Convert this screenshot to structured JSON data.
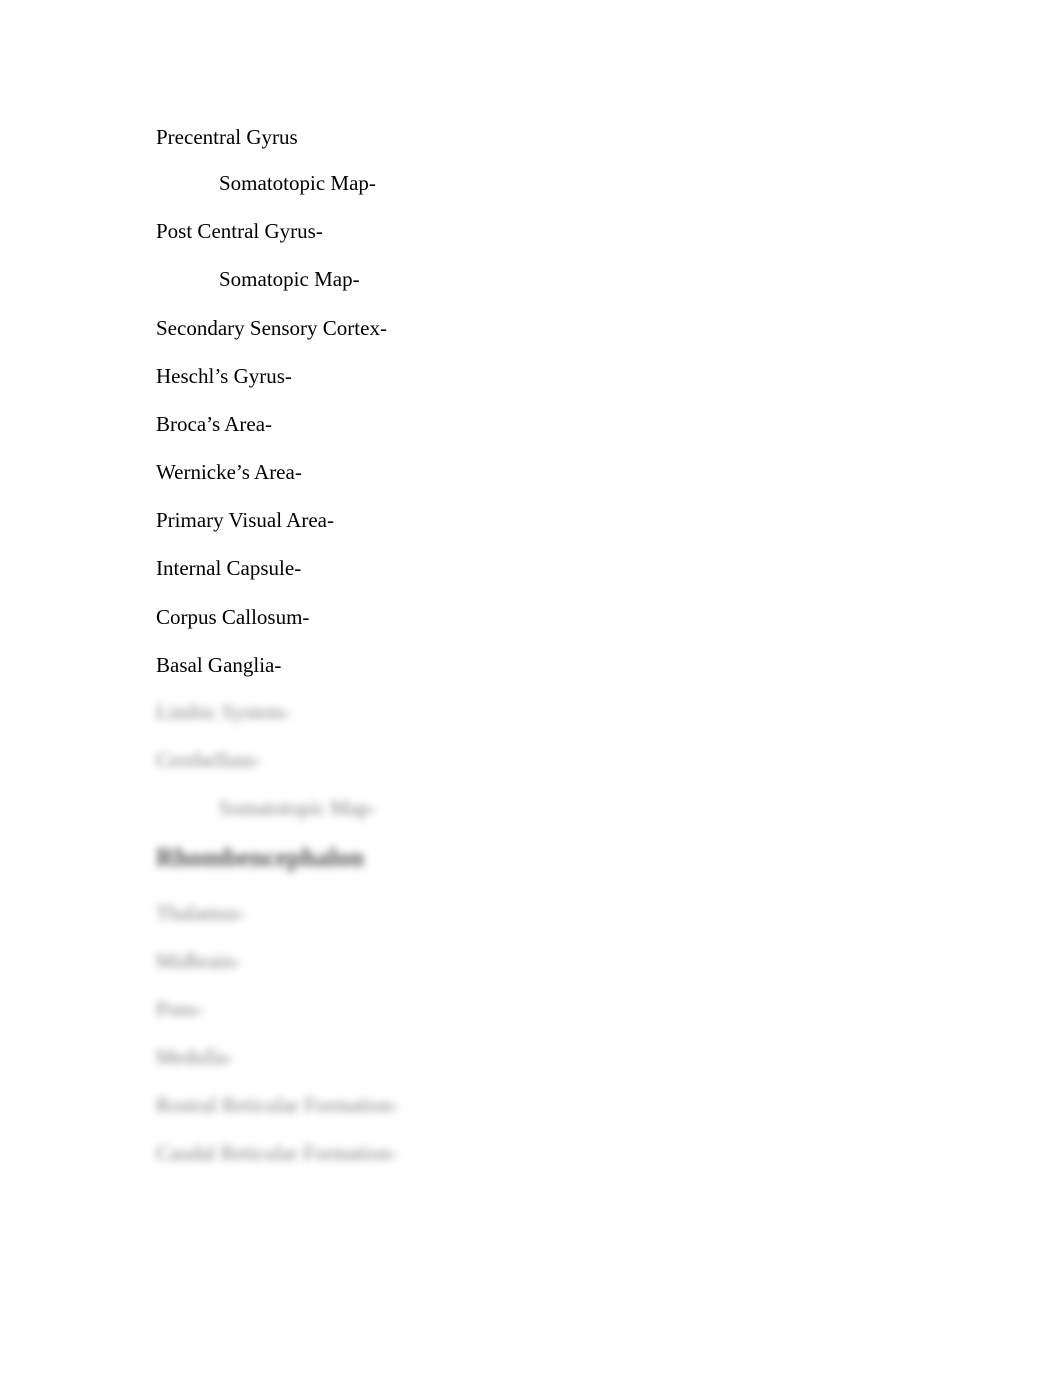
{
  "document": {
    "visible_lines": [
      {
        "text": "Precentral Gyrus",
        "indent": false
      },
      {
        "text": "Somatotopic Map-",
        "indent": true
      },
      {
        "text": "Post Central Gyrus-",
        "indent": false
      },
      {
        "text": "Somatopic Map-",
        "indent": true
      },
      {
        "text": "Secondary Sensory Cortex-",
        "indent": false
      },
      {
        "text": "Heschl’s Gyrus-",
        "indent": false
      },
      {
        "text": "Broca’s Area-",
        "indent": false
      },
      {
        "text": "Wernicke’s Area-",
        "indent": false
      },
      {
        "text": "Primary Visual Area-",
        "indent": false
      },
      {
        "text": "Internal Capsule-",
        "indent": false
      },
      {
        "text": "Corpus Callosum-",
        "indent": false
      },
      {
        "text": "Basal Ganglia-",
        "indent": false
      }
    ],
    "blurred_lines": [
      {
        "text": "Limbic System-",
        "indent": false
      },
      {
        "text": "Cerebellum-",
        "indent": false
      },
      {
        "text": "Somatotopic Map-",
        "indent": true
      },
      {
        "text": "Rhombencephalon",
        "indent": false,
        "heading": true
      },
      {
        "text": "Thalamus-",
        "indent": false
      },
      {
        "text": "Midbrain-",
        "indent": false
      },
      {
        "text": "Pons-",
        "indent": false
      },
      {
        "text": "Medulla-",
        "indent": false
      },
      {
        "text": "Rostral Reticular Formation-",
        "indent": false
      },
      {
        "text": "Caudal Reticular Formation-",
        "indent": false
      }
    ]
  }
}
